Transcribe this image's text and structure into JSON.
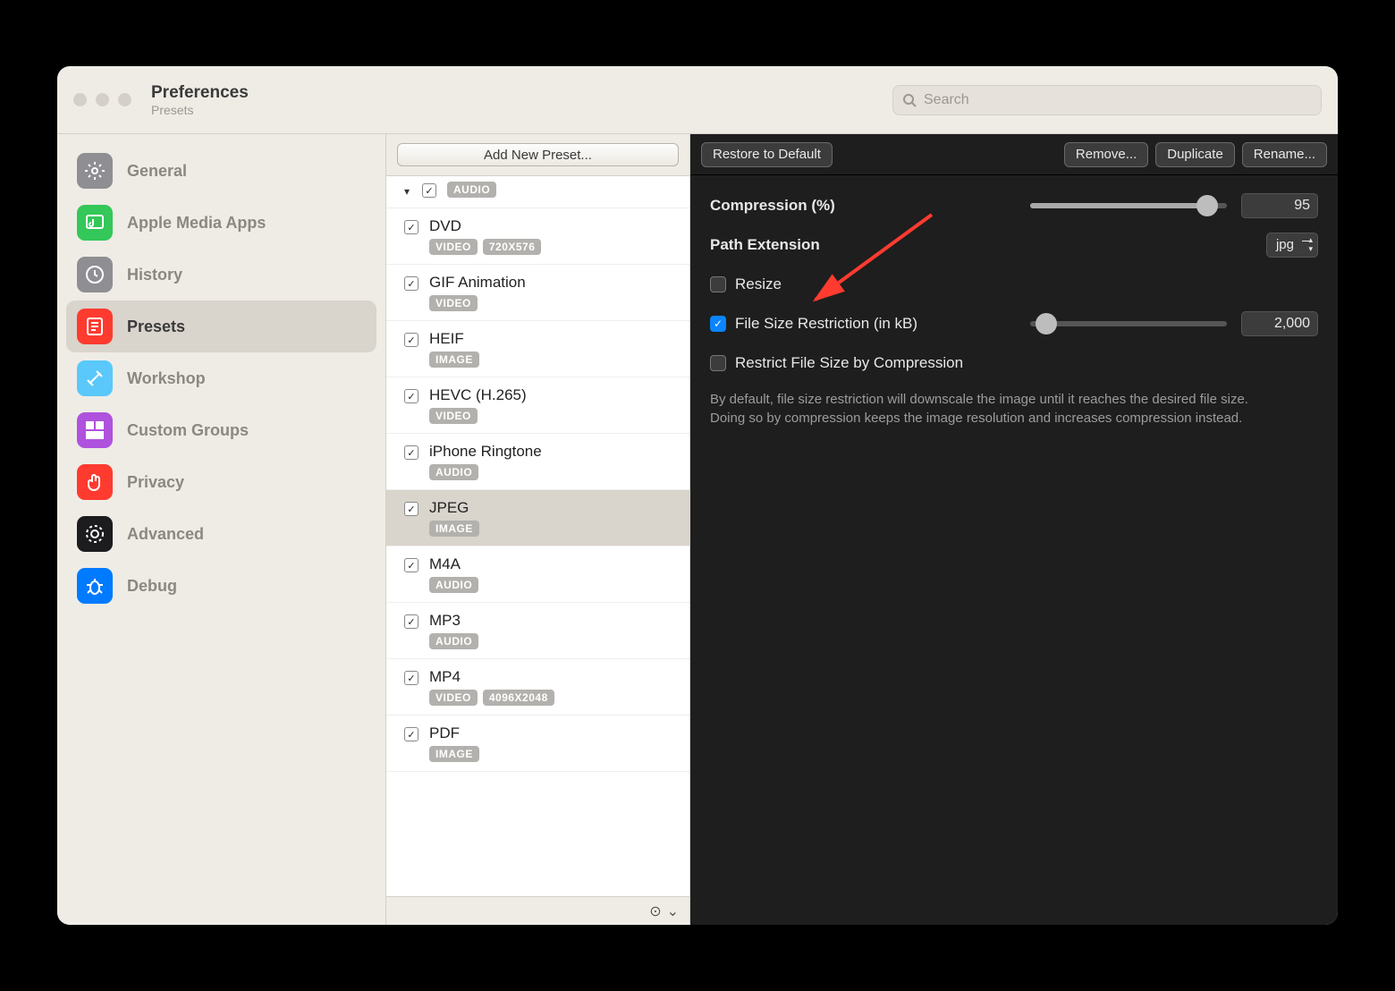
{
  "window": {
    "title": "Preferences",
    "subtitle": "Presets"
  },
  "search": {
    "placeholder": "Search"
  },
  "sidebar": {
    "items": [
      {
        "label": "General",
        "color": "#8e8e93",
        "icon": "gear"
      },
      {
        "label": "Apple Media Apps",
        "color": "#34c759",
        "icon": "music"
      },
      {
        "label": "History",
        "color": "#8e8e93",
        "icon": "clock"
      },
      {
        "label": "Presets",
        "color": "#ff3b30",
        "icon": "presets",
        "active": true
      },
      {
        "label": "Workshop",
        "color": "#5ac8fa",
        "icon": "tools"
      },
      {
        "label": "Custom Groups",
        "color": "#af52de",
        "icon": "grid"
      },
      {
        "label": "Privacy",
        "color": "#ff3b30",
        "icon": "hand"
      },
      {
        "label": "Advanced",
        "color": "#1c1c1e",
        "icon": "cog"
      },
      {
        "label": "Debug",
        "color": "#007aff",
        "icon": "bug"
      }
    ]
  },
  "presets": {
    "add_label": "Add New Preset...",
    "items": [
      {
        "name": "",
        "tags": [
          "AUDIO"
        ],
        "checked": true,
        "disclosure": true,
        "partial": true
      },
      {
        "name": "DVD",
        "tags": [
          "VIDEO",
          "720X576"
        ],
        "checked": true
      },
      {
        "name": "GIF Animation",
        "tags": [
          "VIDEO"
        ],
        "checked": true
      },
      {
        "name": "HEIF",
        "tags": [
          "IMAGE"
        ],
        "checked": true
      },
      {
        "name": "HEVC (H.265)",
        "tags": [
          "VIDEO"
        ],
        "checked": true
      },
      {
        "name": "iPhone Ringtone",
        "tags": [
          "AUDIO"
        ],
        "checked": true
      },
      {
        "name": "JPEG",
        "tags": [
          "IMAGE"
        ],
        "checked": true,
        "selected": true
      },
      {
        "name": "M4A",
        "tags": [
          "AUDIO"
        ],
        "checked": true
      },
      {
        "name": "MP3",
        "tags": [
          "AUDIO"
        ],
        "checked": true
      },
      {
        "name": "MP4",
        "tags": [
          "VIDEO",
          "4096X2048"
        ],
        "checked": true
      },
      {
        "name": "PDF",
        "tags": [
          "IMAGE"
        ],
        "checked": true
      }
    ]
  },
  "detail": {
    "buttons": {
      "restore": "Restore to Default",
      "remove": "Remove...",
      "duplicate": "Duplicate",
      "rename": "Rename..."
    },
    "compression": {
      "label": "Compression (%)",
      "value": "95",
      "pct": 90
    },
    "path_ext": {
      "label": "Path Extension",
      "value": "jpg"
    },
    "resize": {
      "label": "Resize",
      "checked": false
    },
    "filesize": {
      "label": "File Size Restriction (in kB)",
      "checked": true,
      "value": "2,000",
      "pct": 8
    },
    "restrict_comp": {
      "label": "Restrict File Size by Compression",
      "checked": false
    },
    "help": "By default, file size restriction will downscale the image until it reaches the desired file size. Doing so by compression keeps the image resolution and increases compression instead."
  }
}
